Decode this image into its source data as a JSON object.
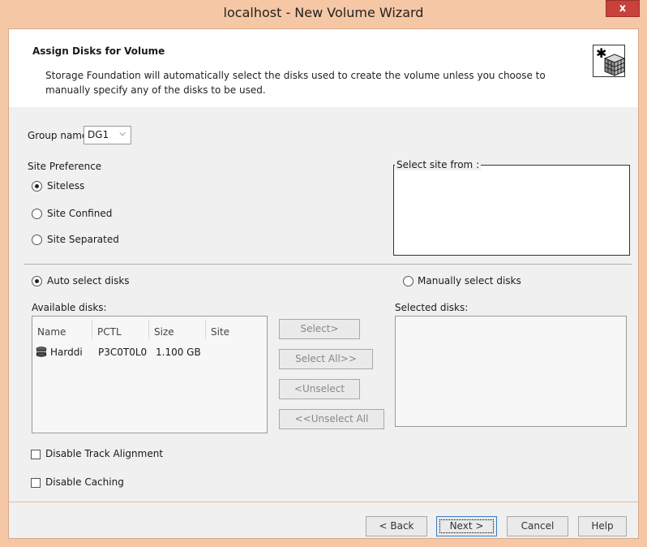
{
  "window": {
    "title": "localhost - New Volume Wizard",
    "close_glyph": "x"
  },
  "header": {
    "title": "Assign Disks for Volume",
    "description": "Storage Foundation will automatically select the disks used to create the volume unless you choose to manually specify any of the disks to be used.",
    "icon": "disk-group-icon"
  },
  "group": {
    "label": "Group name:",
    "value": "DG1"
  },
  "site_preference": {
    "label": "Site Preference",
    "options": [
      {
        "label": "Siteless",
        "checked": true
      },
      {
        "label": "Site Confined",
        "checked": false
      },
      {
        "label": "Site Separated",
        "checked": false
      }
    ],
    "select_site_label": "Select site from :"
  },
  "selection_mode": {
    "auto_label": "Auto select disks",
    "auto_checked": true,
    "manual_label": "Manually select disks",
    "manual_checked": false
  },
  "available": {
    "label": "Available disks:",
    "columns": [
      "Name",
      "PCTL",
      "Size",
      "Site"
    ],
    "rows": [
      {
        "name": "Harddi",
        "pctl": "P3C0T0L0",
        "size": "1.100 GB",
        "site": ""
      }
    ]
  },
  "selected": {
    "label": "Selected disks:"
  },
  "transfer_buttons": {
    "select": "Select>",
    "select_all": "Select All>>",
    "unselect": "<Unselect",
    "unselect_all": "<<Unselect All"
  },
  "options": {
    "disable_track_alignment": "Disable Track Alignment",
    "disable_caching": "Disable Caching"
  },
  "footer": {
    "back": "< Back",
    "next": "Next >",
    "cancel": "Cancel",
    "help": "Help"
  }
}
